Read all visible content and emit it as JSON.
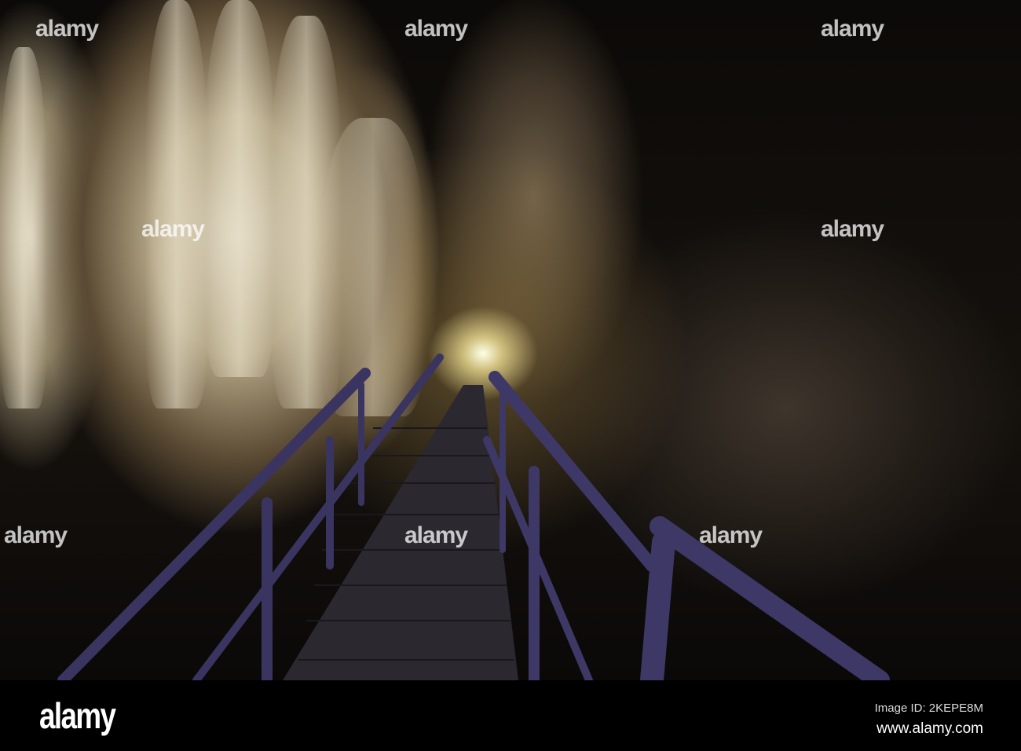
{
  "image": {
    "subject": "photo",
    "watermark_text": "alamy",
    "colors": {
      "rail": "#3a3560",
      "light": "#fff6cc"
    }
  },
  "footer": {
    "logo": "alamy",
    "image_id": "Image ID: 2KEPE8M",
    "url": "www.alamy.com"
  }
}
